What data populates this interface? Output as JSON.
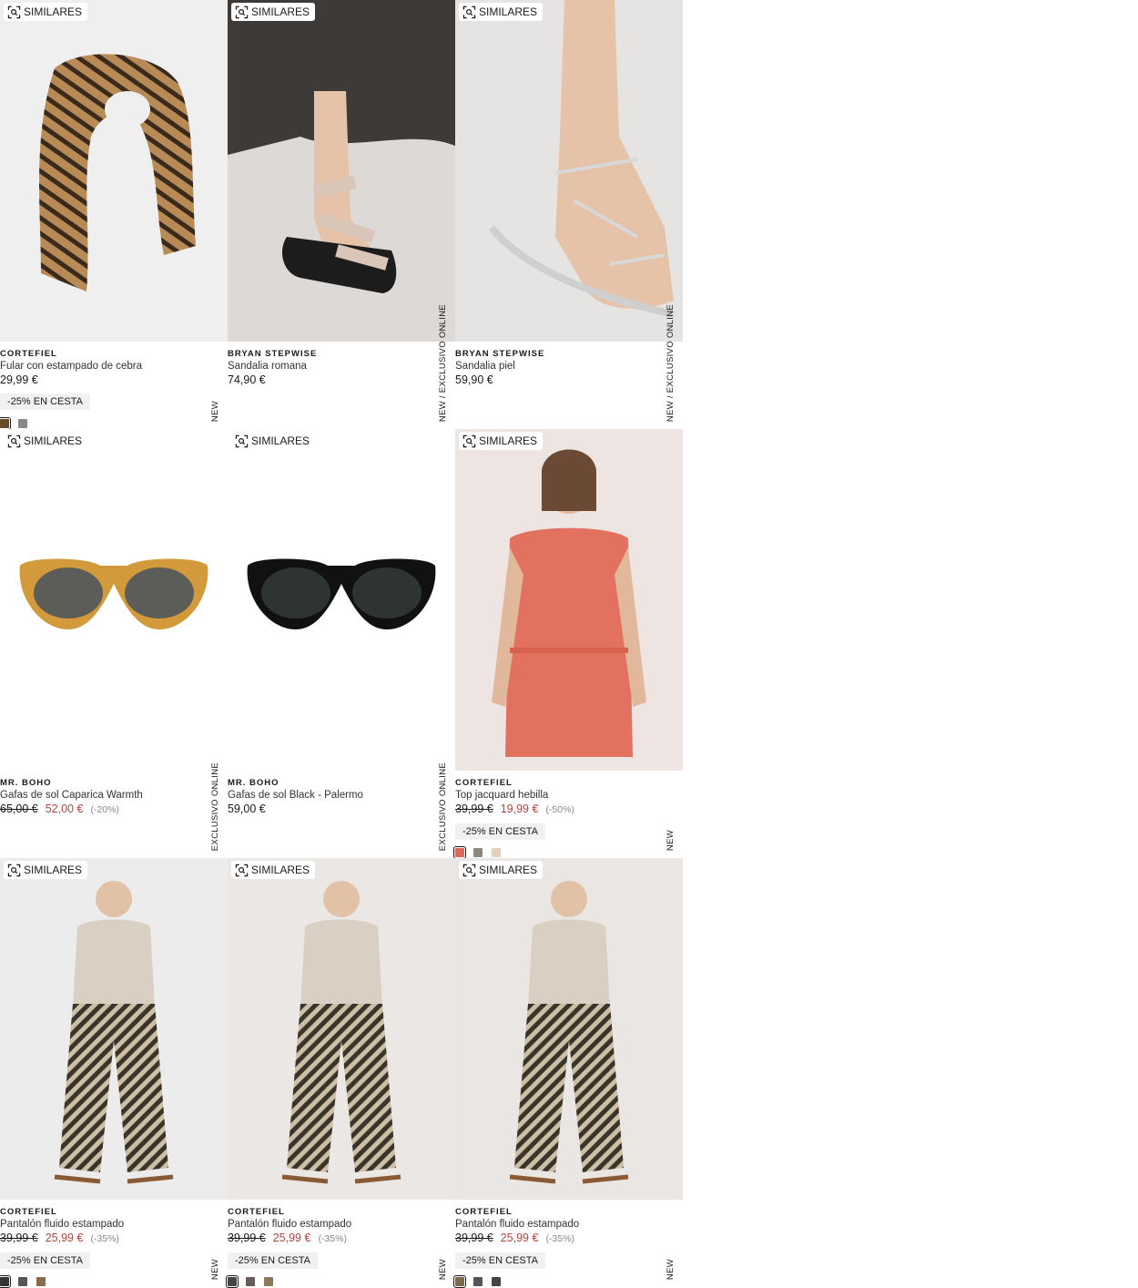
{
  "common": {
    "similar_label": "SIMILARES",
    "similar_icon": "visual-search-icon"
  },
  "products": [
    {
      "brand": "CORTEFIEL",
      "name": "Fular con estampado de cebra",
      "price": "29,99 €",
      "old_price": "",
      "discount": "",
      "promo": "-25% EN CESTA",
      "tag": "NEW",
      "bg": "#efefef",
      "image": "zebra-print-scarf",
      "swatches": [
        "#6b4a2a",
        "#888888"
      ]
    },
    {
      "brand": "BRYAN STEPWISE",
      "name": "Sandalia romana",
      "price": "74,90 €",
      "old_price": "",
      "discount": "",
      "promo": "",
      "tag": "NEW  /  EXCLUSIVO ONLINE",
      "bg": "#dcd9d6",
      "image": "roman-sandal-photo",
      "swatches": []
    },
    {
      "brand": "BRYAN STEPWISE",
      "name": "Sandalia piel",
      "price": "59,90 €",
      "old_price": "",
      "discount": "",
      "promo": "",
      "tag": "NEW  /  EXCLUSIVO ONLINE",
      "bg": "#e6e4e2",
      "image": "leather-sandal-photo",
      "swatches": []
    },
    {
      "brand": "MR. BOHO",
      "name": "Gafas de sol Caparica Warmth",
      "price": "52,00 €",
      "old_price": "65,00 €",
      "discount": "(-20%)",
      "promo": "",
      "tag": "EXCLUSIVO ONLINE",
      "bg": "#ffffff",
      "image": "amber-sunglasses",
      "swatches": []
    },
    {
      "brand": "MR. BOHO",
      "name": "Gafas de sol Black - Palermo",
      "price": "59,00 €",
      "old_price": "",
      "discount": "",
      "promo": "",
      "tag": "EXCLUSIVO ONLINE",
      "bg": "#ffffff",
      "image": "black-sunglasses",
      "swatches": []
    },
    {
      "brand": "CORTEFIEL",
      "name": "Top jacquard hebilla",
      "price": "19,99 €",
      "old_price": "39,99 €",
      "discount": "(-50%)",
      "promo": "-25% EN CESTA",
      "tag": "NEW",
      "bg": "#eee4e1",
      "image": "coral-jacquard-top-photo",
      "swatches": [
        "#e0685a",
        "#8a8a7a",
        "#e4cfc0"
      ]
    },
    {
      "brand": "CORTEFIEL",
      "name": "Pantalón fluido estampado",
      "price": "25,99 €",
      "old_price": "39,99 €",
      "discount": "(-35%)",
      "promo": "-25% EN CESTA",
      "tag": "NEW",
      "bg": "#ececec",
      "image": "printed-trousers-photo",
      "swatches": [
        "#333333",
        "#555555",
        "#8a6a4a"
      ]
    },
    {
      "brand": "CORTEFIEL",
      "name": "Pantalón fluido estampado",
      "price": "25,99 €",
      "old_price": "39,99 €",
      "discount": "(-35%)",
      "promo": "-25% EN CESTA",
      "tag": "NEW",
      "bg": "#ebe7e4",
      "image": "printed-trousers-photo",
      "swatches": [
        "#444444",
        "#6a5a5a",
        "#8a7a5a"
      ]
    },
    {
      "brand": "CORTEFIEL",
      "name": "Pantalón fluido estampado",
      "price": "25,99 €",
      "old_price": "39,99 €",
      "discount": "(-35%)",
      "promo": "-25% EN CESTA",
      "tag": "NEW",
      "bg": "#e9e6e3",
      "image": "printed-trousers-photo",
      "swatches": [
        "#7a6a4a",
        "#555555",
        "#444444"
      ]
    }
  ]
}
